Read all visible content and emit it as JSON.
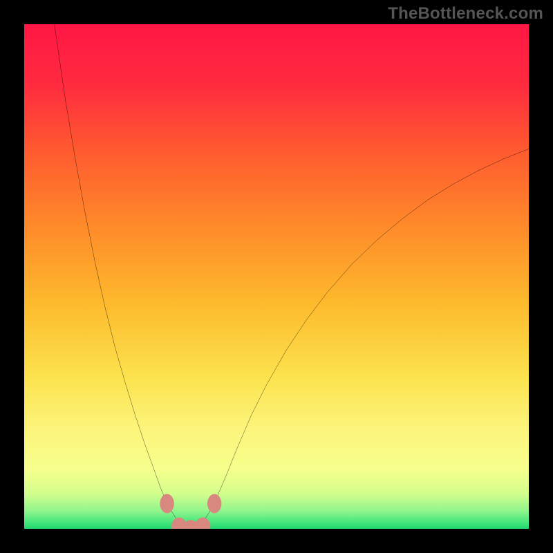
{
  "watermark": "TheBottleneck.com",
  "chart_data": {
    "type": "line",
    "title": "",
    "xlabel": "",
    "ylabel": "",
    "xlim": [
      0,
      100
    ],
    "ylim": [
      0,
      100
    ],
    "background_gradient": {
      "stops": [
        {
          "offset": 0.0,
          "color": "#FF1744"
        },
        {
          "offset": 0.12,
          "color": "#FF2B3F"
        },
        {
          "offset": 0.25,
          "color": "#FF5A2F"
        },
        {
          "offset": 0.4,
          "color": "#FF8A2A"
        },
        {
          "offset": 0.55,
          "color": "#FDB92C"
        },
        {
          "offset": 0.7,
          "color": "#FCE34E"
        },
        {
          "offset": 0.8,
          "color": "#FCF47A"
        },
        {
          "offset": 0.88,
          "color": "#F7FF8C"
        },
        {
          "offset": 0.93,
          "color": "#D4FE8C"
        },
        {
          "offset": 0.965,
          "color": "#8FF58C"
        },
        {
          "offset": 0.985,
          "color": "#4CE87E"
        },
        {
          "offset": 1.0,
          "color": "#1FD96F"
        }
      ]
    },
    "series": [
      {
        "name": "bottleneck-curve",
        "color": "#000000",
        "points": [
          {
            "x": 6.0,
            "y": 100.0
          },
          {
            "x": 8.0,
            "y": 86.0
          },
          {
            "x": 10.0,
            "y": 74.0
          },
          {
            "x": 12.0,
            "y": 63.0
          },
          {
            "x": 14.0,
            "y": 53.0
          },
          {
            "x": 16.0,
            "y": 44.0
          },
          {
            "x": 18.0,
            "y": 36.0
          },
          {
            "x": 20.0,
            "y": 29.0
          },
          {
            "x": 22.0,
            "y": 22.5
          },
          {
            "x": 24.0,
            "y": 16.5
          },
          {
            "x": 26.0,
            "y": 11.0
          },
          {
            "x": 27.0,
            "y": 8.2
          },
          {
            "x": 28.0,
            "y": 5.8
          },
          {
            "x": 29.0,
            "y": 3.8
          },
          {
            "x": 30.0,
            "y": 2.2
          },
          {
            "x": 31.0,
            "y": 1.0
          },
          {
            "x": 32.0,
            "y": 0.4
          },
          {
            "x": 33.0,
            "y": 0.2
          },
          {
            "x": 34.0,
            "y": 0.4
          },
          {
            "x": 35.0,
            "y": 1.0
          },
          {
            "x": 36.0,
            "y": 2.2
          },
          {
            "x": 37.0,
            "y": 3.8
          },
          {
            "x": 38.0,
            "y": 5.8
          },
          {
            "x": 40.0,
            "y": 10.5
          },
          {
            "x": 42.0,
            "y": 15.5
          },
          {
            "x": 45.0,
            "y": 22.5
          },
          {
            "x": 48.0,
            "y": 28.5
          },
          {
            "x": 52.0,
            "y": 35.5
          },
          {
            "x": 56.0,
            "y": 41.5
          },
          {
            "x": 60.0,
            "y": 46.8
          },
          {
            "x": 65.0,
            "y": 52.5
          },
          {
            "x": 70.0,
            "y": 57.3
          },
          {
            "x": 75.0,
            "y": 61.5
          },
          {
            "x": 80.0,
            "y": 65.2
          },
          {
            "x": 85.0,
            "y": 68.3
          },
          {
            "x": 90.0,
            "y": 71.0
          },
          {
            "x": 95.0,
            "y": 73.3
          },
          {
            "x": 100.0,
            "y": 75.3
          }
        ]
      }
    ],
    "markers": [
      {
        "name": "marker-left-upper",
        "x": 28.3,
        "y": 5.0,
        "rx": 1.4,
        "ry": 1.9,
        "color": "#D98880"
      },
      {
        "name": "marker-right-upper",
        "x": 37.7,
        "y": 5.0,
        "rx": 1.4,
        "ry": 1.9,
        "color": "#D98880"
      },
      {
        "name": "marker-left-lower",
        "x": 30.7,
        "y": 0.55,
        "rx": 1.5,
        "ry": 1.7,
        "color": "#D98880"
      },
      {
        "name": "marker-right-lower",
        "x": 35.4,
        "y": 0.55,
        "rx": 1.5,
        "ry": 1.7,
        "color": "#D98880"
      },
      {
        "name": "marker-center",
        "x": 33.0,
        "y": 0.25,
        "rx": 1.5,
        "ry": 1.5,
        "color": "#D98880"
      }
    ]
  }
}
